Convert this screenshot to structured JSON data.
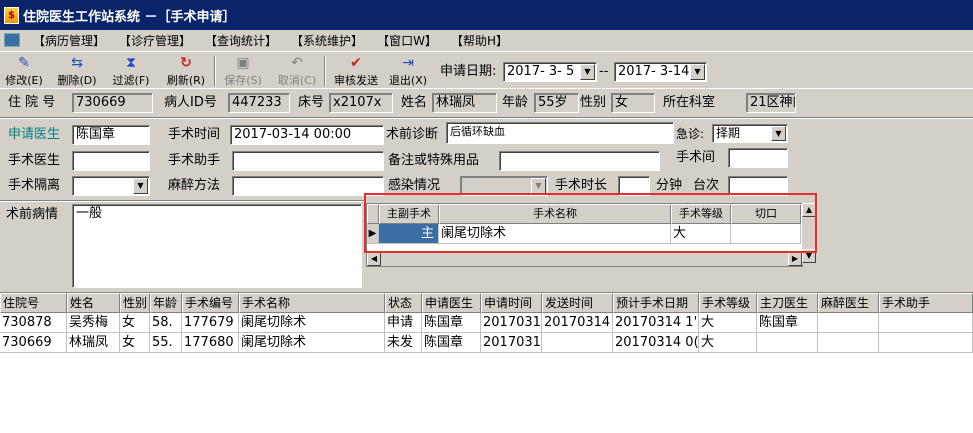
{
  "window": {
    "title": "住院医生工作站系统 －［手术申请］"
  },
  "menu": [
    "【病历管理】",
    "【诊疗管理】",
    "【查询统计】",
    "【系统维护】",
    "【窗口W】",
    "【帮助H】"
  ],
  "toolbar": {
    "modify": "修改(E)",
    "delete": "删除(D)",
    "filter": "过滤(F)",
    "refresh": "刷新(R)",
    "save": "保存(S)",
    "cancel": "取消(C)",
    "review_send": "审核发送",
    "exit": "退出(X)",
    "date_label": "申请日期:",
    "date_from": "2017- 3- 5",
    "date_sep": "--",
    "date_to": "2017- 3-14"
  },
  "patient": {
    "inpatient_no_label": "住 院 号",
    "inpatient_no": "730669",
    "patient_id_label": "病人ID号",
    "patient_id": "447233",
    "bed_no_label": "床号",
    "bed_no": "x2107x",
    "name_label": "姓名",
    "name": "林瑞凤",
    "age_label": "年龄",
    "age": "55岁",
    "sex_label": "性别",
    "sex": "女",
    "dept_label": "所在科室",
    "dept": "21区神内①"
  },
  "form": {
    "applicant_label": "申请医生",
    "applicant": "陈国章",
    "op_time_label": "手术时间",
    "op_time": "2017-03-14 00:00",
    "pre_diag_label": "术前诊断",
    "pre_diag": "后循环缺血",
    "urgent_label": "急诊:",
    "urgent": "择期",
    "surgeon_label": "手术医生",
    "surgeon": "",
    "assistant_label": "手术助手",
    "assistant": "",
    "remarks_label": "备注或特殊用品",
    "remarks": "",
    "op_room_label": "手术间",
    "op_room": "",
    "isolation_label": "手术隔离",
    "isolation": "",
    "anesthesia_label": "麻醉方法",
    "anesthesia": "",
    "infection_label": "感染情况",
    "infection": "",
    "duration_label": "手术时长",
    "duration": "",
    "minutes_label": "分钟",
    "table_no_label": "台次",
    "table_no": "",
    "pre_condition_label": "术前病情",
    "pre_condition": "一般"
  },
  "op_grid": {
    "headers": [
      "主副手术",
      "手术名称",
      "手术等级",
      "切口"
    ],
    "rows": [
      {
        "type": "主",
        "name": "阑尾切除术",
        "grade": "大",
        "incision": ""
      }
    ]
  },
  "list": {
    "headers": [
      "住院号",
      "姓名",
      "性别",
      "年龄",
      "手术编号",
      "手术名称",
      "状态",
      "申请医生",
      "申请时间",
      "发送时间",
      "预计手术日期",
      "手术等级",
      "主刀医生",
      "麻醉医生",
      "手术助手"
    ],
    "rows": [
      [
        "730878",
        "吴秀梅",
        "女",
        "58.",
        "177679",
        "阑尾切除术",
        "申请",
        "陈国章",
        "2017031",
        "20170314",
        "20170314 1'",
        "大",
        "陈国章",
        "",
        ""
      ],
      [
        "730669",
        "林瑞凤",
        "女",
        "55.",
        "177680",
        "阑尾切除术",
        "未发",
        "陈国章",
        "2017031",
        "",
        "20170314 0(",
        "大",
        "",
        "",
        ""
      ]
    ]
  }
}
